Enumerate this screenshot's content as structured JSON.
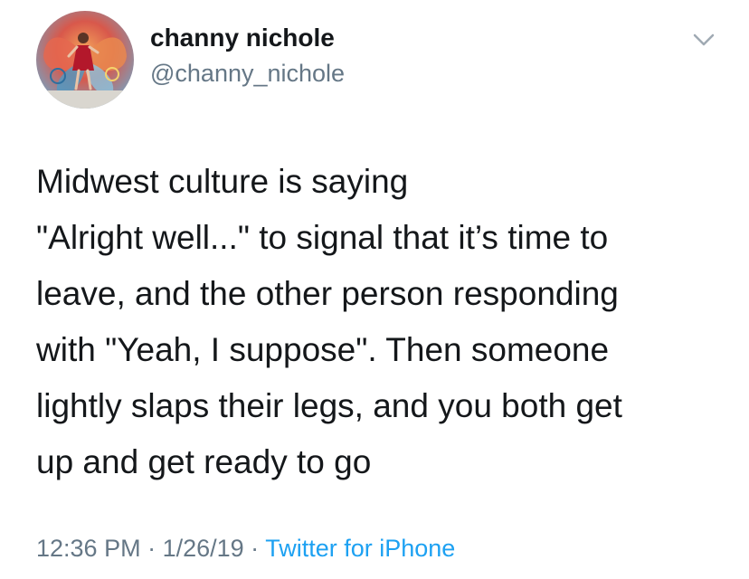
{
  "user": {
    "display_name": "channy nichole",
    "handle": "@channy_nichole",
    "avatar_icon": "profile-photo"
  },
  "tweet": {
    "lines": [
      "Midwest culture is saying",
      "\"Alright well...\" to signal that it’s time to",
      "leave, and the other person responding",
      "with \"Yeah, I suppose\". Then someone",
      "lightly slaps their legs, and you both get",
      "up and get ready to go"
    ]
  },
  "meta": {
    "time": "12:36 PM",
    "separator": " · ",
    "date": "1/26/19",
    "source": "Twitter for iPhone"
  },
  "menu_icon": "chevron-down-icon",
  "colors": {
    "text": "#14171a",
    "secondary": "#657786",
    "link": "#1da1f2"
  }
}
